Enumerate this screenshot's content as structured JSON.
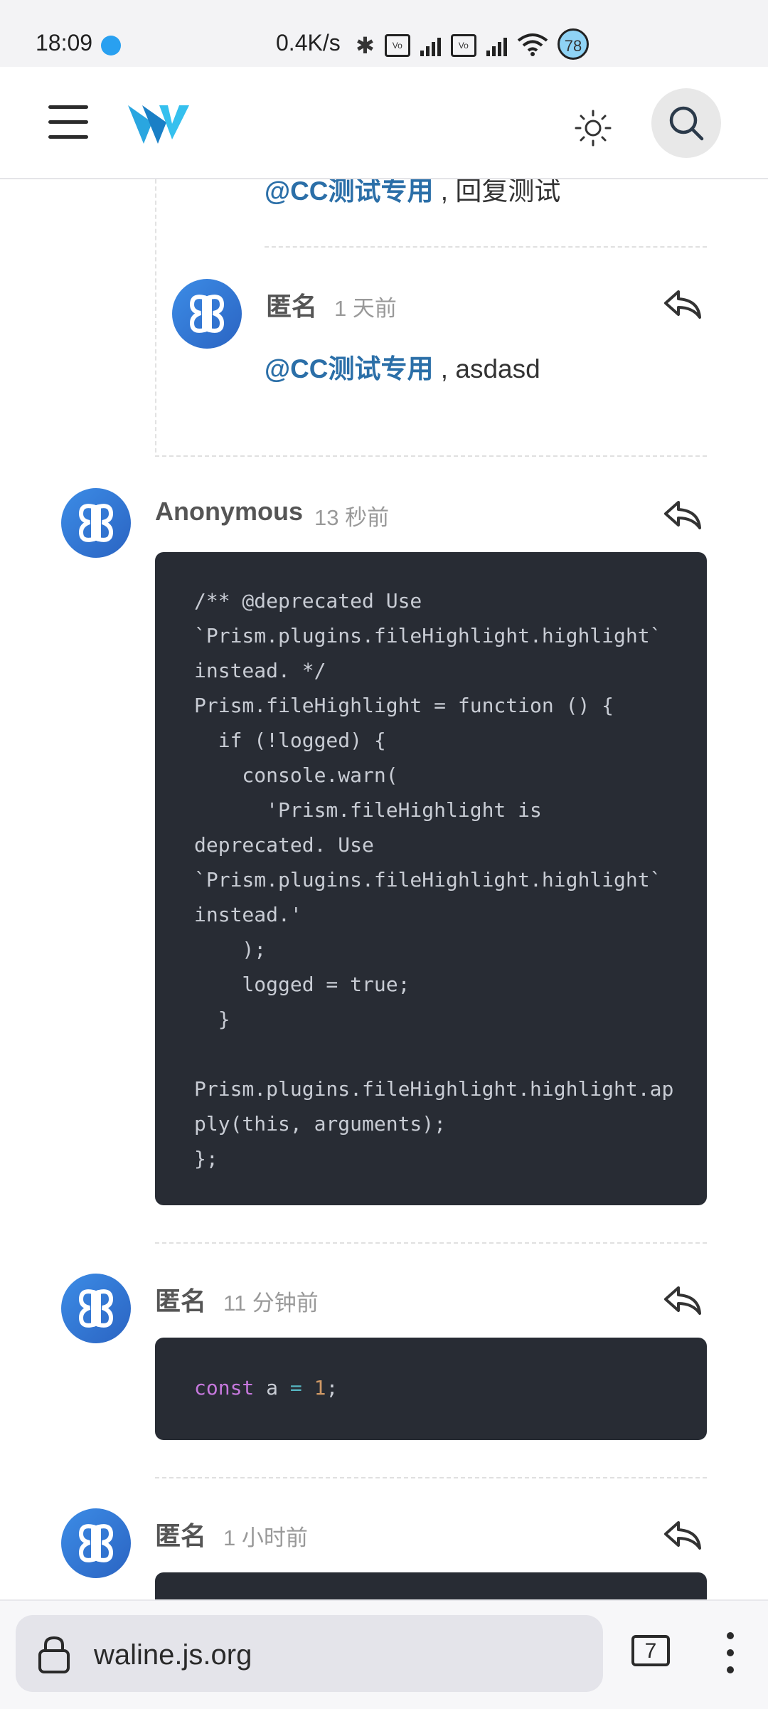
{
  "status_bar": {
    "time": "18:09",
    "net_speed": "0.4K/s",
    "battery": "78",
    "sim_label": "Vo LTE"
  },
  "header": {
    "menu_icon": "menu-icon",
    "logo_icon": "waline-logo",
    "theme_icon": "sun-icon",
    "search_icon": "search-icon"
  },
  "comments": [
    {
      "mention": "@CC测试专用",
      "text": " , 回复测试",
      "partial": true
    },
    {
      "nick": "匿名",
      "time": "1 天前",
      "mention": "@CC测试专用",
      "text": " , asdasd"
    },
    {
      "nick": "Anonymous",
      "time": "13 秒前",
      "code": "/** @deprecated Use\n`Prism.plugins.fileHighlight.highlight`\ninstead. */\nPrism.fileHighlight = function () {\n  if (!logged) {\n    console.warn(\n      'Prism.fileHighlight is\ndeprecated. Use\n`Prism.plugins.fileHighlight.highlight`\ninstead.'\n    );\n    logged = true;\n  }\n\nPrism.plugins.fileHighlight.highlight.ap\nply(this, arguments);\n};"
    },
    {
      "nick": "匿名",
      "time": "11 分钟前",
      "code_tokens": [
        "const",
        " a ",
        "=",
        " ",
        "1",
        ";"
      ]
    },
    {
      "nick": "匿名",
      "time": "1 小时前"
    }
  ],
  "bottom_bar": {
    "url": "waline.js.org",
    "tab_count": "7"
  },
  "colors": {
    "accent_link": "#2b6fa8",
    "avatar": "#3c8ce6",
    "code_bg": "#282c34"
  }
}
